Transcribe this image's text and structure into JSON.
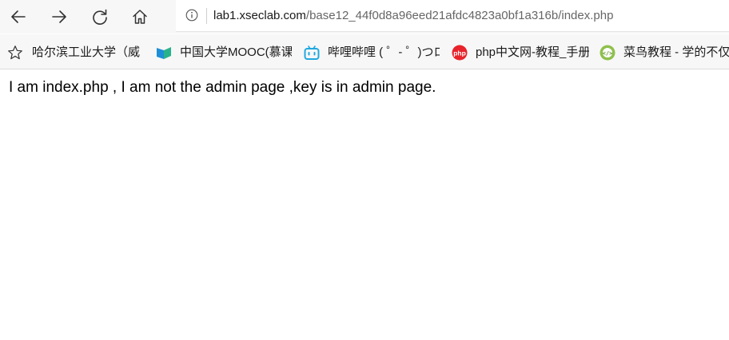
{
  "browser": {
    "address_bar": {
      "url_host": "lab1.xseclab.com",
      "url_path": "/base12_44f0d8a96eed21afdc4823a0bf1a316b/index.php"
    },
    "nav_icons": [
      "back-arrow-icon",
      "forward-arrow-icon",
      "refresh-icon",
      "home-icon"
    ]
  },
  "bookmarks": [
    {
      "label": "哈尔滨工业大学（威",
      "icon": "none"
    },
    {
      "label": "中国大学MOOC(慕课",
      "icon": "mooc-icon"
    },
    {
      "label": "哔哩哔哩 ( ゜- ゜)つロ",
      "icon": "bilibili-icon"
    },
    {
      "label": "php中文网-教程_手册",
      "icon": "php-cn-icon"
    },
    {
      "label": "菜鸟教程 - 学的不仅",
      "icon": "runoob-icon"
    }
  ],
  "page": {
    "text": "I am index.php , I am not the admin page ,key is in admin page."
  }
}
